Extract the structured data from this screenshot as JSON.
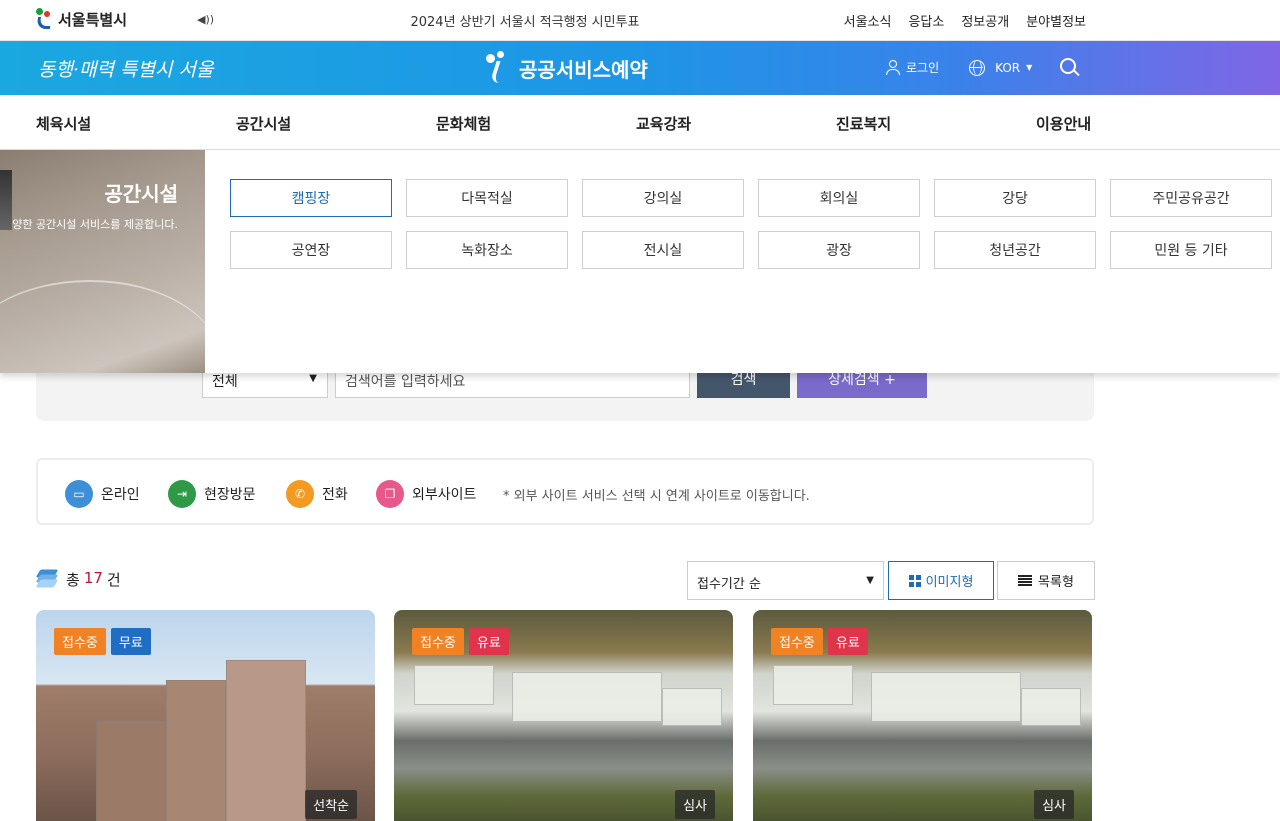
{
  "topbar": {
    "logo_text": "서울특별시",
    "notice": "2024년 상반기 서울시 적극행정 시민투표",
    "links": [
      "서울소식",
      "응답소",
      "정보공개",
      "분야별정보"
    ]
  },
  "header": {
    "slogan": "동행·매력 특별시 서울",
    "service_title": "공공서비스예약",
    "login_label": "로그인",
    "language": "KOR",
    "gradient_colors": [
      "#1aa8e0",
      "#3a82ea",
      "#8066e6"
    ]
  },
  "gnb": {
    "items": [
      "체육시설",
      "공간시설",
      "문화체험",
      "교육강좌",
      "진료복지",
      "이용안내"
    ]
  },
  "mega_menu": {
    "title": "공간시설",
    "description": "양한 공간시설 서비스를 제공합니다.",
    "buttons": [
      "캠핑장",
      "다목적실",
      "강의실",
      "회의실",
      "강당",
      "주민공유공간",
      "공연장",
      "녹화장소",
      "전시실",
      "광장",
      "청년공간",
      "민원 등 기타"
    ],
    "active_button": "캠핑장"
  },
  "search": {
    "category_value": "전체",
    "keyword_placeholder": "검색어를 입력하세요",
    "search_label": "검색",
    "detail_label": "상세검색 +"
  },
  "legend": {
    "items": [
      {
        "label": "온라인",
        "color": "#3d8fd8",
        "icon": "monitor-icon"
      },
      {
        "label": "현장방문",
        "color": "#2e9a48",
        "icon": "door-enter-icon"
      },
      {
        "label": "전화",
        "color": "#f29a22",
        "icon": "phone-icon"
      },
      {
        "label": "외부사이트",
        "color": "#e8588a",
        "icon": "external-link-icon"
      }
    ],
    "note": "* 외부 사이트 서비스 선택 시 연계 사이트로 이동합니다."
  },
  "results": {
    "total_prefix": "총",
    "total_count": "17",
    "total_suffix": "건",
    "sort_value": "접수기간 순",
    "view_image_label": "이미지형",
    "view_list_label": "목록형"
  },
  "cards": [
    {
      "status": "접수중",
      "fee": "무료",
      "method": "선착순"
    },
    {
      "status": "접수중",
      "fee": "유료",
      "method": "심사"
    },
    {
      "status": "접수중",
      "fee": "유료",
      "method": "심사"
    }
  ]
}
